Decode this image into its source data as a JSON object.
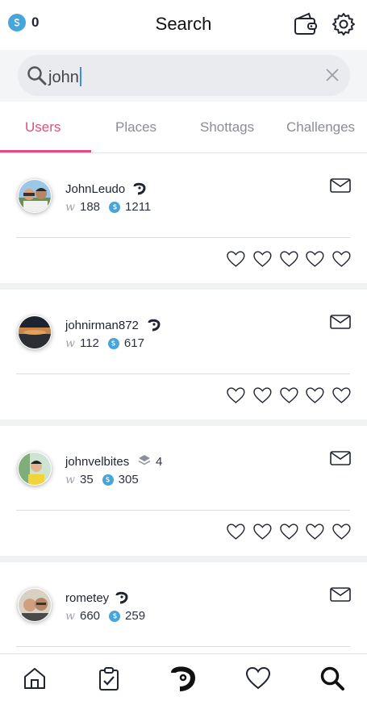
{
  "header": {
    "coin_count": "0",
    "title": "Search",
    "icons": {
      "coin": "coin-icon",
      "wallet": "wallet-icon",
      "settings": "gear-icon"
    }
  },
  "search": {
    "value": "john",
    "clear_icon": "close-icon"
  },
  "tabs": [
    {
      "label": "Users",
      "active": true
    },
    {
      "label": "Places",
      "active": false
    },
    {
      "label": "Shottags",
      "active": false
    },
    {
      "label": "Challenges",
      "active": false
    }
  ],
  "colors": {
    "accent": "#e04d84",
    "coin": "#47a5db",
    "text": "#1f2430"
  },
  "users": [
    {
      "name": "JohnLeudo",
      "w_score": "188",
      "coins": "1211",
      "badge": "shot-logo-icon",
      "likes_given": 0
    },
    {
      "name": "johnirman872",
      "w_score": "112",
      "coins": "617",
      "badge": "shot-logo-icon",
      "likes_given": 0
    },
    {
      "name": "johnvelbites",
      "w_score": "35",
      "coins": "305",
      "badge": "layers-icon",
      "level": "4",
      "likes_given": 0
    },
    {
      "name": "rometey",
      "w_score": "660",
      "coins": "259",
      "badge": "shot-logo-icon",
      "likes_given": 0
    }
  ],
  "bottom_nav": [
    "home-icon",
    "clipboard-check-icon",
    "shot-logo-icon",
    "heart-icon",
    "search-icon"
  ]
}
